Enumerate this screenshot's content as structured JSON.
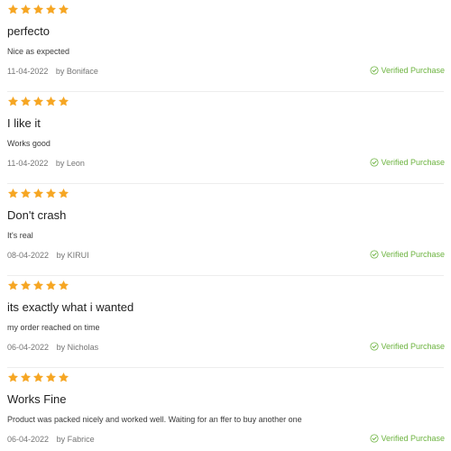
{
  "theme": {
    "star_color": "#f6a623",
    "verified_color": "#6cb33f"
  },
  "reviews": [
    {
      "rating": 5,
      "title": "perfecto",
      "body": "Nice as expected",
      "date": "11-04-2022",
      "author": "by Boniface",
      "verified_label": "Verified Purchase",
      "verified_icon": "check-circle-icon"
    },
    {
      "rating": 5,
      "title": "I like it",
      "body": "Works good",
      "date": "11-04-2022",
      "author": "by Leon",
      "verified_label": "Verified Purchase",
      "verified_icon": "check-circle-icon"
    },
    {
      "rating": 5,
      "title": "Don't crash",
      "body": "It's real",
      "date": "08-04-2022",
      "author": "by KIRUI",
      "verified_label": "Verified Purchase",
      "verified_icon": "check-circle-icon"
    },
    {
      "rating": 5,
      "title": "its exactly what i wanted",
      "body": "my order reached on time",
      "date": "06-04-2022",
      "author": "by Nicholas",
      "verified_label": "Verified Purchase",
      "verified_icon": "check-circle-icon"
    },
    {
      "rating": 5,
      "title": "Works Fine",
      "body": "Product was packed nicely and worked well. Waiting for an ffer to buy another one",
      "date": "06-04-2022",
      "author": "by Fabrice",
      "verified_label": "Verified Purchase",
      "verified_icon": "check-circle-icon"
    }
  ]
}
